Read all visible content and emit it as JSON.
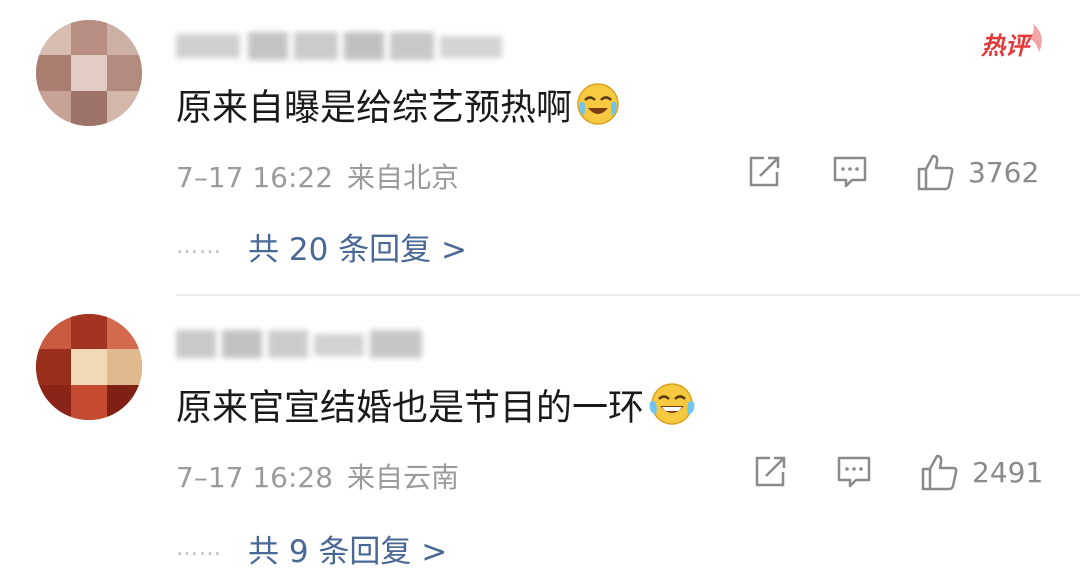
{
  "comments": [
    {
      "badge": "热评",
      "text": "原来自曝是给综艺预热啊",
      "emoji": "laugh-cry-emoji",
      "time": "7–17 16:22",
      "location": "来自北京",
      "likes": "3762",
      "replies": "共 20 条回复 >",
      "reply_dots": "……"
    },
    {
      "text": "原来官宣结婚也是节目的一环",
      "emoji": "tears-of-joy-emoji",
      "time": "7–17 16:28",
      "location": "来自云南",
      "likes": "2491",
      "replies": "共 9 条回复 >",
      "reply_dots": "……"
    }
  ],
  "colors": {
    "link": "#4a6896",
    "meta": "#9b9b9b",
    "hot_badge": "#e23a3a"
  }
}
